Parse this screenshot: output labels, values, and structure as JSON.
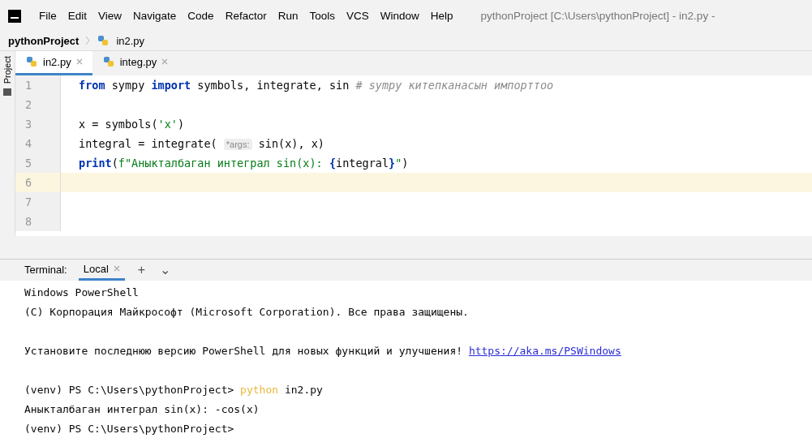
{
  "menu": [
    "File",
    "Edit",
    "View",
    "Navigate",
    "Code",
    "Refactor",
    "Run",
    "Tools",
    "VCS",
    "Window",
    "Help"
  ],
  "window": {
    "title": "pythonProject [C:\\Users\\pythonProject] - in2.py -"
  },
  "breadcrumb": [
    {
      "label": "pythonProject",
      "kind": "folder"
    },
    {
      "label": "in2.py",
      "kind": "file"
    }
  ],
  "side_tab": "Project",
  "tabs": [
    {
      "label": "in2.py",
      "selected": true
    },
    {
      "label": "integ.py",
      "selected": false
    }
  ],
  "editor": {
    "lines": [
      {
        "number": "1",
        "current": false,
        "tokens": [
          {
            "kind": "keyword",
            "text": "from"
          },
          {
            "kind": "plain",
            "text": " sympy "
          },
          {
            "kind": "keyword",
            "text": "import"
          },
          {
            "kind": "plain",
            "text": " symbols, integrate, sin "
          },
          {
            "kind": "comment",
            "text": "# sympy китепканасын импорттоо"
          }
        ]
      },
      {
        "number": "2",
        "current": false
      },
      {
        "number": "3",
        "current": false,
        "tokens": [
          {
            "kind": "plain",
            "text": "x = symbols("
          },
          {
            "kind": "string",
            "text": "'x'"
          },
          {
            "kind": "plain",
            "text": ")"
          }
        ]
      },
      {
        "number": "4",
        "current": false,
        "tokens": [
          {
            "kind": "plain",
            "text": "integral = integrate( "
          },
          {
            "kind": "hint",
            "text": "*args:"
          },
          {
            "kind": "plain",
            "text": " sin(x), x)"
          }
        ]
      },
      {
        "number": "5",
        "current": false,
        "tokens": [
          {
            "kind": "keyword",
            "text": "print"
          },
          {
            "kind": "plain",
            "text": "("
          },
          {
            "kind": "string",
            "text": "f\"Аныкталбаган интеграл sin(x): "
          },
          {
            "kind": "keyword",
            "text": "{"
          },
          {
            "kind": "plain",
            "text": "integral"
          },
          {
            "kind": "keyword",
            "text": "}"
          },
          {
            "kind": "string",
            "text": "\""
          },
          {
            "kind": "plain",
            "text": ")"
          }
        ]
      },
      {
        "number": "6",
        "current": true
      },
      {
        "number": "7",
        "current": false
      },
      {
        "number": "8",
        "current": false
      }
    ]
  },
  "terminal": {
    "title": "Terminal:",
    "tabs": [
      {
        "label": "Local",
        "selected": true
      }
    ],
    "add": "+",
    "menu": "⌄",
    "lines": [
      {
        "segments": [
          {
            "kind": "plain",
            "text": "Windows PowerShell"
          }
        ]
      },
      {
        "segments": [
          {
            "kind": "plain",
            "text": "(C) Корпорация Майкрософт (Microsoft Corporation). Все права защищены."
          }
        ]
      },
      {
        "blank": true
      },
      {
        "segments": [
          {
            "kind": "plain",
            "text": "Установите последнюю версию PowerShell для новых функций и улучшения! "
          },
          {
            "kind": "link",
            "text": "https://aka.ms/PSWindows"
          }
        ]
      },
      {
        "blank": true
      },
      {
        "segments": [
          {
            "kind": "plain",
            "text": "(venv) PS C:\\Users\\pythonProject> "
          },
          {
            "kind": "command",
            "text": "python"
          },
          {
            "kind": "plain",
            "text": " in2.py"
          }
        ]
      },
      {
        "segments": [
          {
            "kind": "plain",
            "text": "Аныкталбаган интеграл sin(x): -cos(x)"
          }
        ]
      },
      {
        "segments": [
          {
            "kind": "plain",
            "text": "(venv) PS C:\\Users\\pythonProject>"
          }
        ]
      }
    ]
  }
}
